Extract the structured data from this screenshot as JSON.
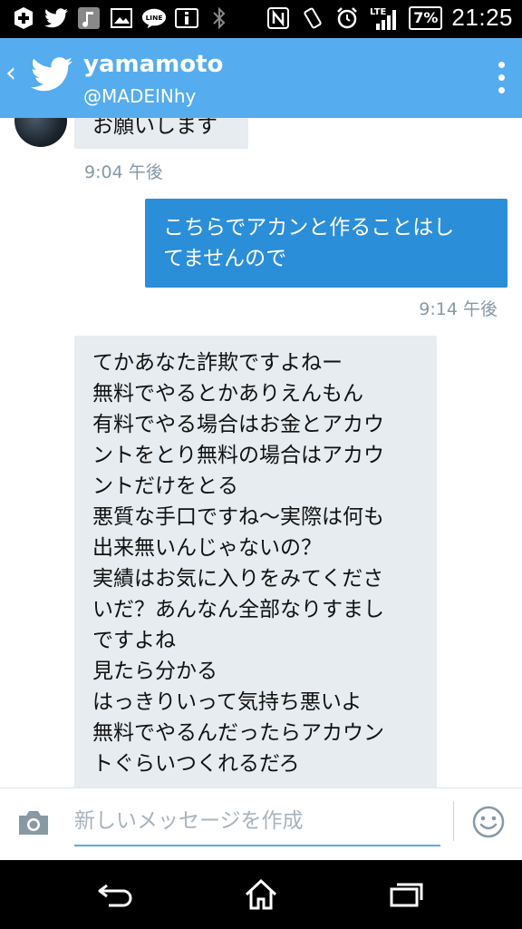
{
  "status_bar": {
    "network": "LTE",
    "battery": "7%",
    "time": "21:25",
    "icons": [
      "add-icon",
      "twitter-icon",
      "music-icon",
      "image-icon",
      "line-icon",
      "info-icon",
      "bluetooth-icon",
      "nfc-icon",
      "rotate-icon",
      "alarm-icon",
      "signal-icon"
    ]
  },
  "header": {
    "name": "yamamoto",
    "handle": "@MADEINhy",
    "back_icon": "chevron-left-icon",
    "logo_icon": "twitter-bird-icon",
    "menu_icon": "more-vertical-icon",
    "accent": "#55acee"
  },
  "messages": [
    {
      "from": "them",
      "lines": [
        "お願いします"
      ],
      "timestamp": "9:04 午後"
    },
    {
      "from": "me",
      "lines": [
        "こちらでアカンと作ることはし",
        "てませんので"
      ],
      "timestamp": "9:14 午後"
    },
    {
      "from": "them",
      "lines": [
        "てかあなた詐欺ですよねー",
        "無料でやるとかありえんもん",
        "有料でやる場合はお金とアカウ",
        "ントをとり無料の場合はアカウ",
        "ントだけをとる",
        "悪質な手口ですね〜実際は何も",
        "出来無いんじゃないの？",
        "実績はお気に入りをみてくださ",
        "いだ？あんなん全部なりすまし",
        "ですよね",
        "見たら分かる",
        "はっきりいって気持ち悪いよ",
        "無料でやるんだったらアカウン",
        "トぐらいつくれるだろ"
      ]
    }
  ],
  "composer": {
    "placeholder": "新しいメッセージを作成",
    "value": "",
    "camera_icon": "camera-icon",
    "emoji_icon": "emoji-icon"
  },
  "nav_bar": {
    "icons": [
      "back-icon",
      "home-icon",
      "recents-icon"
    ]
  },
  "colors": {
    "outgoing_bubble": "#2b8ed9",
    "incoming_bubble": "#e6ecf0",
    "timestamp": "#8899a6"
  }
}
